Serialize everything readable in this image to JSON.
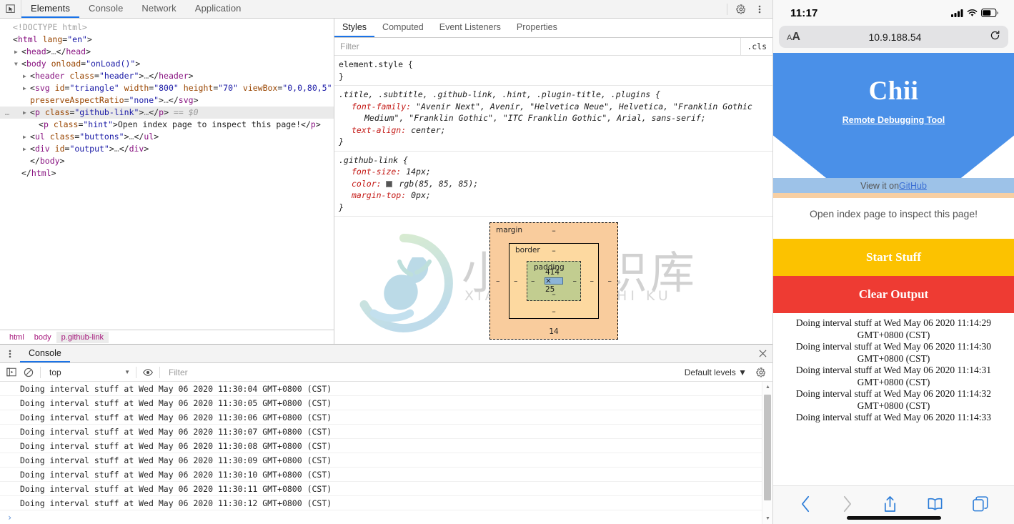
{
  "devtools": {
    "tabs": [
      {
        "label": "Elements",
        "active": true
      },
      {
        "label": "Console",
        "active": false
      },
      {
        "label": "Network",
        "active": false
      },
      {
        "label": "Application",
        "active": false
      }
    ],
    "inspect_icon": "inspect-cursor-icon",
    "settings_icon": "gear-icon",
    "more_icon": "kebab-menu-icon",
    "dom": {
      "lines": [
        {
          "indent": 0,
          "arrow": "none",
          "selected": false,
          "parts": [
            {
              "t": "doctype",
              "v": "<!DOCTYPE html>"
            }
          ]
        },
        {
          "indent": 0,
          "arrow": "none",
          "selected": false,
          "parts": [
            {
              "t": "punc",
              "v": "<"
            },
            {
              "t": "tag",
              "v": "html"
            },
            {
              "t": "sp",
              "v": " "
            },
            {
              "t": "attr",
              "v": "lang"
            },
            {
              "t": "punc",
              "v": "="
            },
            {
              "t": "val",
              "v": "\"en\""
            },
            {
              "t": "punc",
              "v": ">"
            }
          ]
        },
        {
          "indent": 1,
          "arrow": "closed",
          "selected": false,
          "parts": [
            {
              "t": "punc",
              "v": "<"
            },
            {
              "t": "tag",
              "v": "head"
            },
            {
              "t": "punc",
              "v": ">"
            },
            {
              "t": "ellip",
              "v": "…"
            },
            {
              "t": "punc",
              "v": "</"
            },
            {
              "t": "tag",
              "v": "head"
            },
            {
              "t": "punc",
              "v": ">"
            }
          ]
        },
        {
          "indent": 1,
          "arrow": "open",
          "selected": false,
          "parts": [
            {
              "t": "punc",
              "v": "<"
            },
            {
              "t": "tag",
              "v": "body"
            },
            {
              "t": "sp",
              "v": " "
            },
            {
              "t": "attr",
              "v": "onload"
            },
            {
              "t": "punc",
              "v": "="
            },
            {
              "t": "val",
              "v": "\"onLoad()\""
            },
            {
              "t": "punc",
              "v": ">"
            }
          ]
        },
        {
          "indent": 2,
          "arrow": "closed",
          "selected": false,
          "parts": [
            {
              "t": "punc",
              "v": "<"
            },
            {
              "t": "tag",
              "v": "header"
            },
            {
              "t": "sp",
              "v": " "
            },
            {
              "t": "attr",
              "v": "class"
            },
            {
              "t": "punc",
              "v": "="
            },
            {
              "t": "val",
              "v": "\"header\""
            },
            {
              "t": "punc",
              "v": ">"
            },
            {
              "t": "ellip",
              "v": "…"
            },
            {
              "t": "punc",
              "v": "</"
            },
            {
              "t": "tag",
              "v": "header"
            },
            {
              "t": "punc",
              "v": ">"
            }
          ]
        },
        {
          "indent": 2,
          "arrow": "closed",
          "selected": false,
          "parts": [
            {
              "t": "punc",
              "v": "<"
            },
            {
              "t": "tag",
              "v": "svg"
            },
            {
              "t": "sp",
              "v": " "
            },
            {
              "t": "attr",
              "v": "id"
            },
            {
              "t": "punc",
              "v": "="
            },
            {
              "t": "val",
              "v": "\"triangle\""
            },
            {
              "t": "sp",
              "v": " "
            },
            {
              "t": "attr",
              "v": "width"
            },
            {
              "t": "punc",
              "v": "="
            },
            {
              "t": "val",
              "v": "\"800\""
            },
            {
              "t": "sp",
              "v": " "
            },
            {
              "t": "attr",
              "v": "height"
            },
            {
              "t": "punc",
              "v": "="
            },
            {
              "t": "val",
              "v": "\"70\""
            },
            {
              "t": "sp",
              "v": " "
            },
            {
              "t": "attr",
              "v": "viewBox"
            },
            {
              "t": "punc",
              "v": "="
            },
            {
              "t": "val",
              "v": "\"0,0,80,5\""
            }
          ]
        },
        {
          "indent": 2,
          "arrow": "none",
          "wrap": true,
          "selected": false,
          "parts": [
            {
              "t": "attr",
              "v": "preserveAspectRatio"
            },
            {
              "t": "punc",
              "v": "="
            },
            {
              "t": "val",
              "v": "\"none\""
            },
            {
              "t": "punc",
              "v": ">"
            },
            {
              "t": "ellip",
              "v": "…"
            },
            {
              "t": "punc",
              "v": "</"
            },
            {
              "t": "tag",
              "v": "svg"
            },
            {
              "t": "punc",
              "v": ">"
            }
          ]
        },
        {
          "indent": 2,
          "arrow": "closed",
          "selected": true,
          "gutter": "…",
          "parts": [
            {
              "t": "punc",
              "v": "<"
            },
            {
              "t": "tag",
              "v": "p"
            },
            {
              "t": "sp",
              "v": " "
            },
            {
              "t": "attr",
              "v": "class"
            },
            {
              "t": "punc",
              "v": "="
            },
            {
              "t": "val",
              "v": "\"github-link\""
            },
            {
              "t": "punc",
              "v": ">"
            },
            {
              "t": "ellip",
              "v": "…"
            },
            {
              "t": "punc",
              "v": "</"
            },
            {
              "t": "tag",
              "v": "p"
            },
            {
              "t": "punc",
              "v": ">"
            },
            {
              "t": "selmark",
              "v": " == $0"
            }
          ]
        },
        {
          "indent": 3,
          "arrow": "none",
          "selected": false,
          "parts": [
            {
              "t": "punc",
              "v": "<"
            },
            {
              "t": "tag",
              "v": "p"
            },
            {
              "t": "sp",
              "v": " "
            },
            {
              "t": "attr",
              "v": "class"
            },
            {
              "t": "punc",
              "v": "="
            },
            {
              "t": "val",
              "v": "\"hint\""
            },
            {
              "t": "punc",
              "v": ">"
            },
            {
              "t": "txt",
              "v": "Open index page to inspect this page!"
            },
            {
              "t": "punc",
              "v": "</"
            },
            {
              "t": "tag",
              "v": "p"
            },
            {
              "t": "punc",
              "v": ">"
            }
          ]
        },
        {
          "indent": 2,
          "arrow": "closed",
          "selected": false,
          "parts": [
            {
              "t": "punc",
              "v": "<"
            },
            {
              "t": "tag",
              "v": "ul"
            },
            {
              "t": "sp",
              "v": " "
            },
            {
              "t": "attr",
              "v": "class"
            },
            {
              "t": "punc",
              "v": "="
            },
            {
              "t": "val",
              "v": "\"buttons\""
            },
            {
              "t": "punc",
              "v": ">"
            },
            {
              "t": "ellip",
              "v": "…"
            },
            {
              "t": "punc",
              "v": "</"
            },
            {
              "t": "tag",
              "v": "ul"
            },
            {
              "t": "punc",
              "v": ">"
            }
          ]
        },
        {
          "indent": 2,
          "arrow": "closed",
          "selected": false,
          "parts": [
            {
              "t": "punc",
              "v": "<"
            },
            {
              "t": "tag",
              "v": "div"
            },
            {
              "t": "sp",
              "v": " "
            },
            {
              "t": "attr",
              "v": "id"
            },
            {
              "t": "punc",
              "v": "="
            },
            {
              "t": "val",
              "v": "\"output\""
            },
            {
              "t": "punc",
              "v": ">"
            },
            {
              "t": "ellip",
              "v": "…"
            },
            {
              "t": "punc",
              "v": "</"
            },
            {
              "t": "tag",
              "v": "div"
            },
            {
              "t": "punc",
              "v": ">"
            }
          ]
        },
        {
          "indent": 2,
          "arrow": "none",
          "selected": false,
          "parts": [
            {
              "t": "punc",
              "v": "</"
            },
            {
              "t": "tag",
              "v": "body"
            },
            {
              "t": "punc",
              "v": ">"
            }
          ]
        },
        {
          "indent": 1,
          "arrow": "none",
          "selected": false,
          "parts": [
            {
              "t": "punc",
              "v": "</"
            },
            {
              "t": "tag",
              "v": "html"
            },
            {
              "t": "punc",
              "v": ">"
            }
          ]
        }
      ]
    },
    "breadcrumbs": [
      {
        "label": "html",
        "active": false
      },
      {
        "label": "body",
        "active": false
      },
      {
        "label": "p.github-link",
        "active": true
      }
    ],
    "styles": {
      "tabs": [
        {
          "label": "Styles",
          "active": true
        },
        {
          "label": "Computed",
          "active": false
        },
        {
          "label": "Event Listeners",
          "active": false
        },
        {
          "label": "Properties",
          "active": false
        }
      ],
      "filter_placeholder": "Filter",
      "filter_value": "",
      "cls_label": ".cls",
      "rules": [
        {
          "selector": "element.style {",
          "italic": false,
          "props": [],
          "close": "}"
        },
        {
          "selector": ".title, .subtitle, .github-link, .hint, .plugin-title, .plugins {",
          "italic": true,
          "props": [
            {
              "name": "font-family:",
              "value": " \"Avenir Next\", Avenir, \"Helvetica Neue\", Helvetica, \"Franklin Gothic",
              "cont": "Medium\", \"Franklin Gothic\", \"ITC Franklin Gothic\", Arial, sans-serif;"
            },
            {
              "name": "text-align:",
              "value": " center;"
            }
          ],
          "close": "}"
        },
        {
          "selector": ".github-link {",
          "italic": true,
          "props": [
            {
              "name": "font-size:",
              "value": " 14px;"
            },
            {
              "name": "color:",
              "value": " rgb(85, 85, 85);",
              "swatch": "#555555"
            },
            {
              "name": "margin-top:",
              "value": " 0px;"
            }
          ],
          "close": "}"
        }
      ]
    },
    "boxmodel": {
      "margin_label": "margin",
      "border_label": "border",
      "padding_label": "padding",
      "content_size": "414 × 25",
      "margin_top": "–",
      "margin_right": "–",
      "margin_bottom": "14",
      "margin_left": "–",
      "border_top": "–",
      "border_right": "–",
      "border_bottom": "–",
      "border_left": "–",
      "padding_top": "–",
      "padding_right": "–",
      "padding_bottom": "–",
      "padding_left": "–"
    },
    "watermark": {
      "cn": "小牛知识库",
      "pinyin": "XIAO NIU ZHI SHI KU"
    },
    "drawer": {
      "kebab_icon": "kebab-menu-icon",
      "tab_label": "Console",
      "close_icon": "close-icon",
      "toolbar": {
        "sidebar_icon": "show-console-sidebar-icon",
        "clear_icon": "clear-console-icon",
        "context_value": "top",
        "eye_icon": "live-expression-icon",
        "filter_placeholder": "Filter",
        "filter_value": "",
        "levels_label": "Default levels ▼",
        "settings_icon": "gear-icon"
      },
      "logs": [
        "Doing interval stuff at Wed May 06 2020 11:30:04 GMT+0800 (CST)",
        "Doing interval stuff at Wed May 06 2020 11:30:05 GMT+0800 (CST)",
        "Doing interval stuff at Wed May 06 2020 11:30:06 GMT+0800 (CST)",
        "Doing interval stuff at Wed May 06 2020 11:30:07 GMT+0800 (CST)",
        "Doing interval stuff at Wed May 06 2020 11:30:08 GMT+0800 (CST)",
        "Doing interval stuff at Wed May 06 2020 11:30:09 GMT+0800 (CST)",
        "Doing interval stuff at Wed May 06 2020 11:30:10 GMT+0800 (CST)",
        "Doing interval stuff at Wed May 06 2020 11:30:11 GMT+0800 (CST)",
        "Doing interval stuff at Wed May 06 2020 11:30:12 GMT+0800 (CST)"
      ],
      "prompt": "›"
    }
  },
  "phone": {
    "status": {
      "time": "11:17",
      "cellular_icon": "cellular-signal-icon",
      "wifi_icon": "wifi-icon",
      "battery_icon": "battery-icon"
    },
    "urlbar": {
      "aa_label": "AA",
      "url": "10.9.188.54",
      "reload_icon": "reload-icon"
    },
    "hero": {
      "title": "Chii",
      "subtitle": "Remote Debugging Tool",
      "bg_color": "#4a90e8"
    },
    "github_band": {
      "prefix": "View it on ",
      "link": "GitHub",
      "highlight_content_color": "#9dc2e8",
      "highlight_margin_color": "#f7cfa3"
    },
    "hint": "Open index page to inspect this page!",
    "buttons": [
      {
        "label": "Start Stuff",
        "color": "#fcc200"
      },
      {
        "label": "Clear Output",
        "color": "#ee3b33"
      }
    ],
    "output": [
      "Doing interval stuff at Wed May 06 2020 11:14:29",
      "GMT+0800 (CST)",
      "Doing interval stuff at Wed May 06 2020 11:14:30",
      "GMT+0800 (CST)",
      "Doing interval stuff at Wed May 06 2020 11:14:31",
      "GMT+0800 (CST)",
      "Doing interval stuff at Wed May 06 2020 11:14:32",
      "GMT+0800 (CST)",
      "Doing interval stuff at Wed May 06 2020 11:14:33"
    ],
    "toolbar": [
      {
        "icon": "back-arrow-icon",
        "enabled": true
      },
      {
        "icon": "forward-arrow-icon",
        "enabled": false
      },
      {
        "icon": "share-icon",
        "enabled": true
      },
      {
        "icon": "bookmarks-icon",
        "enabled": true
      },
      {
        "icon": "tabs-icon",
        "enabled": true
      }
    ]
  }
}
